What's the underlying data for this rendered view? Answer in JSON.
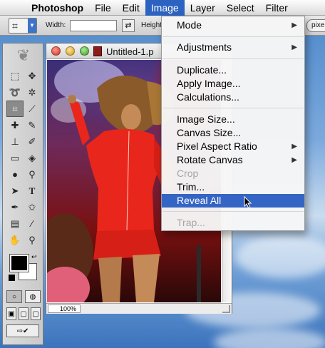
{
  "menubar": {
    "app": "Photoshop",
    "items": [
      "File",
      "Edit",
      "Image",
      "Layer",
      "Select",
      "Filter"
    ],
    "active": "Image"
  },
  "options_bar": {
    "width_label": "Width:",
    "height_label": "Height",
    "units_button": "pixe"
  },
  "document": {
    "title": "Untitled-1.p",
    "zoom": "100%"
  },
  "image_menu": {
    "items": [
      {
        "label": "Mode",
        "submenu": true
      },
      {
        "label": "Adjustments",
        "submenu": true
      },
      {
        "label": "Duplicate..."
      },
      {
        "label": "Apply Image..."
      },
      {
        "label": "Calculations..."
      },
      {
        "label": "Image Size..."
      },
      {
        "label": "Canvas Size..."
      },
      {
        "label": "Pixel Aspect Ratio",
        "submenu": true
      },
      {
        "label": "Rotate Canvas",
        "submenu": true
      },
      {
        "label": "Crop",
        "disabled": true
      },
      {
        "label": "Trim..."
      },
      {
        "label": "Reveal All",
        "highlighted": true
      },
      {
        "label": "Trap...",
        "disabled": true
      }
    ]
  },
  "colors": {
    "menu_highlight": "#3565c4",
    "menubar_active": "#2d63c0",
    "dress_red": "#e8261c",
    "foreground_swatch": "#000000",
    "background_swatch": "#ffffff"
  },
  "icons": [
    "apple-icon",
    "crop-icon",
    "swap-dimensions-icon",
    "feather-icon",
    "marquee-icon",
    "move-icon",
    "lasso-icon",
    "magic-wand-icon",
    "crop-tool-icon",
    "slice-icon",
    "healing-icon",
    "brush-icon",
    "clone-stamp-icon",
    "history-brush-icon",
    "eraser-icon",
    "paint-bucket-icon",
    "blur-icon",
    "dodge-icon",
    "path-select-icon",
    "type-icon",
    "pen-icon",
    "shape-icon",
    "notes-icon",
    "eyedropper-icon",
    "hand-icon",
    "zoom-icon",
    "submenu-arrow-icon",
    "arrow-cursor-icon"
  ]
}
